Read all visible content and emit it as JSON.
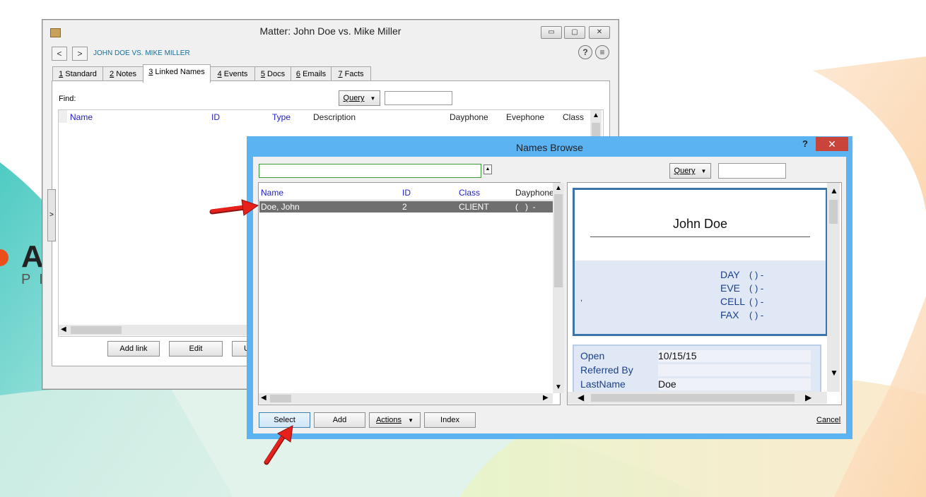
{
  "colors": {
    "window_bg": "#f0f0f0",
    "browse_frame": "#5cb3f2",
    "close_red": "#c9443a",
    "header_blue": "#1e1ec8",
    "selection_gray": "#6f6f6f",
    "card_border": "#3c73a8",
    "arrow_red": "#e8201b"
  },
  "matter": {
    "title": "Matter: John Doe vs. Mike Miller",
    "matter_name": "JOHN DOE VS. MIKE MILLER",
    "nav_back_icon": "chevron-left-icon",
    "nav_forward_icon": "chevron-right-icon",
    "help_label": "?",
    "menu_label": "≡",
    "tabs": [
      {
        "num": "1",
        "label": " Standard"
      },
      {
        "num": "2",
        "label": " Notes"
      },
      {
        "num": "3",
        "label": " Linked Names"
      },
      {
        "num": "4",
        "label": " Events"
      },
      {
        "num": "5",
        "label": " Docs"
      },
      {
        "num": "6",
        "label": " Emails"
      },
      {
        "num": "7",
        "label": " Facts"
      }
    ],
    "find_label": "Find:",
    "query_label": "Query",
    "columns": [
      "Name",
      "ID",
      "Type",
      "Description",
      "Dayphone",
      "Evephone",
      "Class"
    ],
    "side_toggle": ">",
    "buttons": {
      "add_link": "Add link",
      "edit": "Edit",
      "partial": "U"
    }
  },
  "browse": {
    "title": "Names Browse",
    "help": "?",
    "close": "✕",
    "query_label": "Query",
    "columns": [
      "Name",
      "ID",
      "Class",
      "Dayphone"
    ],
    "rows": [
      {
        "name": "Doe, John",
        "id": "2",
        "class": "CLIENT",
        "dayphone": "(   )  -"
      }
    ],
    "card": {
      "name": "John Doe",
      "comma": ",",
      "phones": [
        {
          "label": "DAY",
          "value": "( ) -"
        },
        {
          "label": "EVE",
          "value": "( ) -"
        },
        {
          "label": "CELL",
          "value": "( ) -"
        },
        {
          "label": "FAX",
          "value": "( ) -"
        }
      ],
      "info": [
        {
          "label": "Open",
          "value": "10/15/15"
        },
        {
          "label": "Referred By",
          "value": ""
        },
        {
          "label": "LastName",
          "value": "Doe"
        }
      ]
    },
    "buttons": {
      "select": "Select",
      "add": "Add",
      "actions": "Actions",
      "index": "Index",
      "cancel": "Cancel"
    }
  }
}
